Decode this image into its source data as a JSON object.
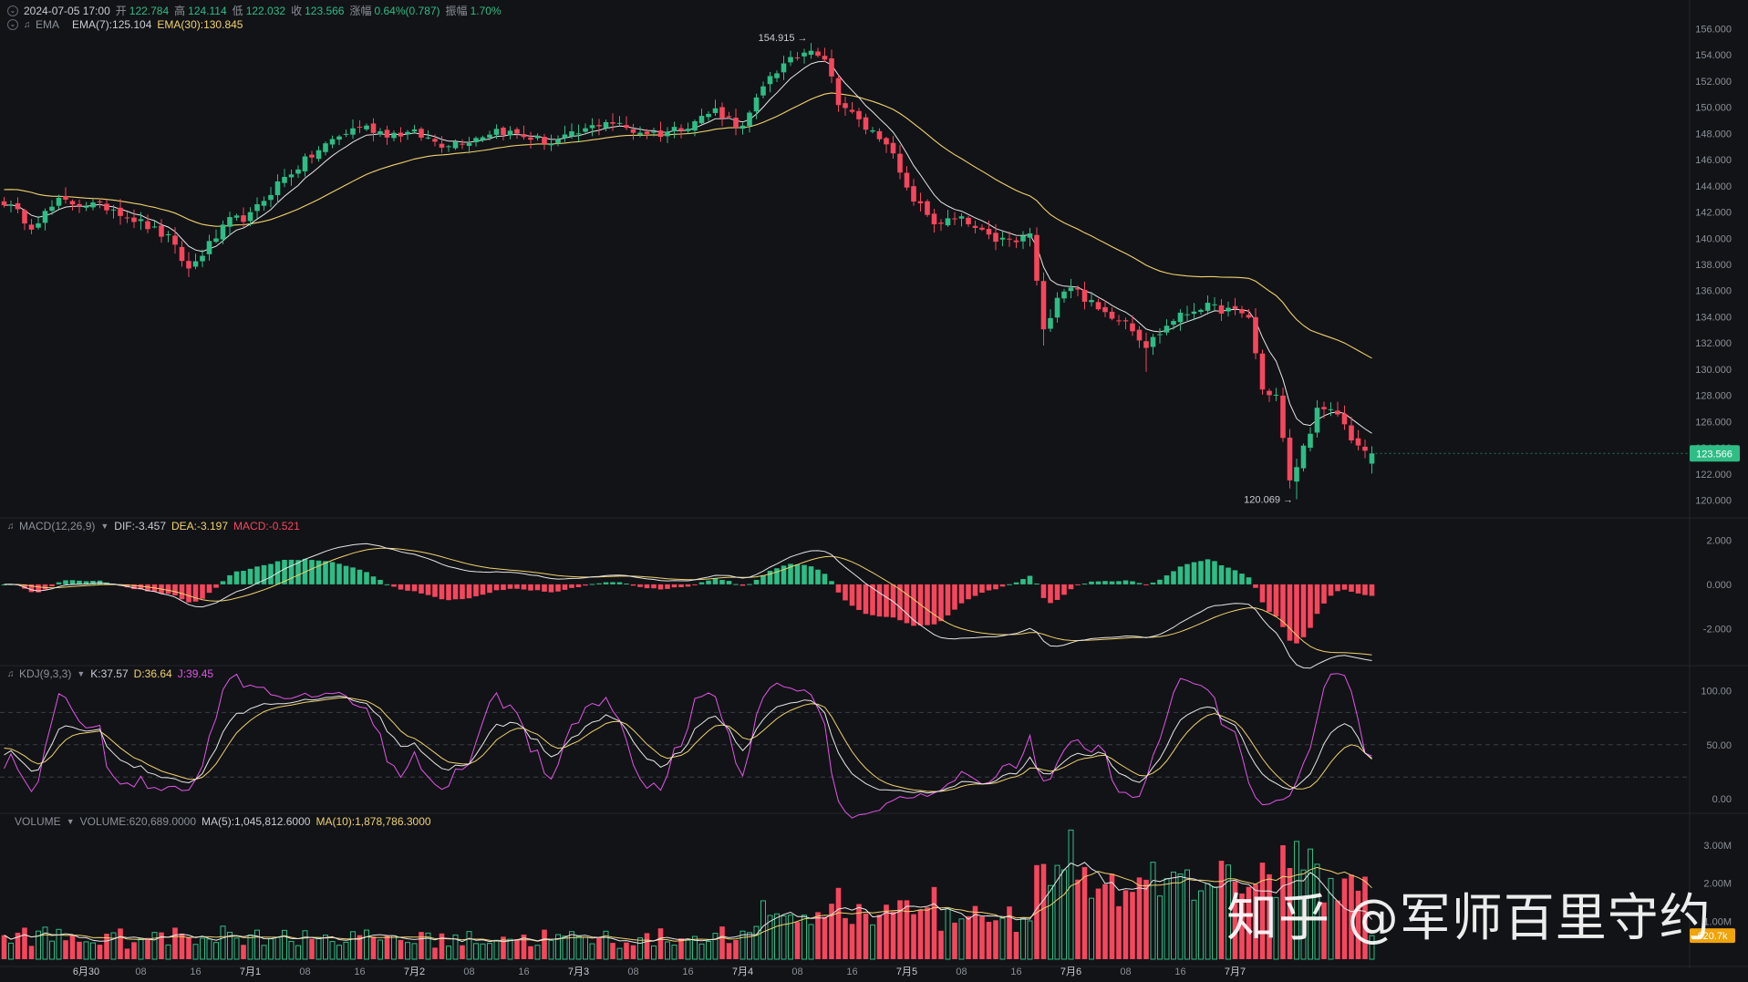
{
  "ohlc_header": {
    "date": "2024-07-05 17:00",
    "open_label": "开",
    "open": "122.784",
    "high_label": "高",
    "high": "124.114",
    "low_label": "低",
    "low": "122.032",
    "close_label": "收",
    "close": "123.566",
    "change_label": "涨幅",
    "change": "0.64%(0.787)",
    "amp_label": "振幅",
    "amp": "1.70%"
  },
  "ema_header": {
    "name": "EMA",
    "ema7": "EMA(7):125.104",
    "ema30": "EMA(30):130.845"
  },
  "macd_header": {
    "name": "MACD(12,26,9)",
    "dif": "DIF:-3.457",
    "dea": "DEA:-3.197",
    "macd": "MACD:-0.521"
  },
  "kdj_header": {
    "name": "KDJ(9,3,3)",
    "k": "K:37.57",
    "d": "D:36.64",
    "j": "J:39.45"
  },
  "vol_header": {
    "name": "VOLUME",
    "vol": "VOLUME:620,689.0000",
    "ma5": "MA(5):1,045,812.6000",
    "ma10": "MA(10):1,878,786.3000"
  },
  "watermark": "知乎 @军师百里守约",
  "colors": {
    "up": "#2ebd85",
    "down": "#f6465d",
    "ema7": "#e6e6e6",
    "ema30": "#f0d26e",
    "k": "#e6e6e6",
    "d": "#f0d26e",
    "j": "#e255e8",
    "bg": "#121316"
  },
  "chart_data": {
    "type": "candlestick",
    "interval": "1h",
    "x_ticks": [
      "6月30",
      "08",
      "16",
      "7月1",
      "08",
      "16",
      "7月2",
      "08",
      "16",
      "7月3",
      "08",
      "16",
      "7月4",
      "08",
      "16",
      "7月5",
      "08",
      "16",
      "7月6",
      "08",
      "16",
      "7月7"
    ],
    "price_axis": {
      "ticks": [
        "156.000",
        "154.000",
        "152.000",
        "150.000",
        "148.000",
        "146.000",
        "144.000",
        "142.000",
        "140.000",
        "138.000",
        "136.000",
        "134.000",
        "132.000",
        "130.000",
        "128.000",
        "126.000",
        "124.000",
        "122.000",
        "120.000"
      ],
      "range": [
        119.2,
        156.8
      ]
    },
    "last_price_tag": "123.566",
    "high_marker": "154.915",
    "low_marker": "120.069",
    "macd_axis": {
      "ticks": [
        "2.000",
        "0.000",
        "-2.000"
      ],
      "range": [
        -3.6,
        2.6
      ]
    },
    "kdj_axis": {
      "ticks": [
        "100.00",
        "50.00",
        "0.00"
      ],
      "range": [
        -12,
        115
      ],
      "guides": [
        20,
        50,
        80
      ]
    },
    "volume_axis": {
      "ticks": [
        "3.00M",
        "2.00M",
        "1.00M"
      ],
      "range": [
        0,
        3.6
      ],
      "unit": "M"
    },
    "last_volume_tag": "620.7k",
    "close_keypoints": [
      [
        0,
        142.8
      ],
      [
        4,
        141.0
      ],
      [
        8,
        142.8
      ],
      [
        12,
        142.6
      ],
      [
        16,
        142.3
      ],
      [
        20,
        141.2
      ],
      [
        24,
        140.0
      ],
      [
        27,
        137.6
      ],
      [
        30,
        139.5
      ],
      [
        33,
        141.3
      ],
      [
        36,
        141.7
      ],
      [
        40,
        144.2
      ],
      [
        44,
        145.9
      ],
      [
        48,
        147.5
      ],
      [
        52,
        148.6
      ],
      [
        56,
        148.0
      ],
      [
        60,
        148.0
      ],
      [
        64,
        147.2
      ],
      [
        68,
        147.5
      ],
      [
        72,
        148.3
      ],
      [
        76,
        147.8
      ],
      [
        80,
        147.3
      ],
      [
        84,
        148.0
      ],
      [
        88,
        149.0
      ],
      [
        92,
        148.2
      ],
      [
        96,
        148.0
      ],
      [
        100,
        148.7
      ],
      [
        104,
        149.8
      ],
      [
        108,
        148.4
      ],
      [
        112,
        152.5
      ],
      [
        115,
        153.5
      ],
      [
        118,
        154.6
      ],
      [
        120,
        153.8
      ],
      [
        122,
        150.5
      ],
      [
        126,
        148.4
      ],
      [
        129,
        147.5
      ],
      [
        132,
        143.6
      ],
      [
        136,
        141.2
      ],
      [
        140,
        141.4
      ],
      [
        144,
        140.0
      ],
      [
        148,
        139.7
      ],
      [
        150,
        140.4
      ],
      [
        152,
        132.8
      ],
      [
        154,
        135.7
      ],
      [
        156,
        136.4
      ],
      [
        160,
        134.5
      ],
      [
        164,
        133.8
      ],
      [
        167,
        131.8
      ],
      [
        171,
        133.8
      ],
      [
        175,
        134.8
      ],
      [
        179,
        134.5
      ],
      [
        182,
        134.0
      ],
      [
        184,
        128.4
      ],
      [
        186,
        128.0
      ],
      [
        188,
        121.3
      ],
      [
        190,
        124.0
      ],
      [
        192,
        126.8
      ],
      [
        195,
        126.6
      ],
      [
        197,
        124.8
      ],
      [
        199,
        123.5
      ],
      [
        200,
        123.6
      ]
    ],
    "ema7_last": 125.104,
    "ema30_last": 130.845,
    "macd_last": {
      "dif": -3.457,
      "dea": -3.197,
      "hist": -0.521
    },
    "kdj_last": {
      "k": 37.57,
      "d": 36.64,
      "j": 39.45
    },
    "volume_last": 620689,
    "volume_ma5_last": 1045812.6,
    "volume_ma10_last": 1878786.3,
    "volume_spikes": [
      [
        156,
        3.4
      ],
      [
        136,
        1.9
      ],
      [
        173,
        2.35
      ],
      [
        180,
        2.05
      ],
      [
        187,
        3.0
      ],
      [
        189,
        3.1
      ],
      [
        191,
        2.9
      ],
      [
        192,
        2.5
      ],
      [
        188,
        2.4
      ],
      [
        132,
        1.55
      ]
    ]
  }
}
